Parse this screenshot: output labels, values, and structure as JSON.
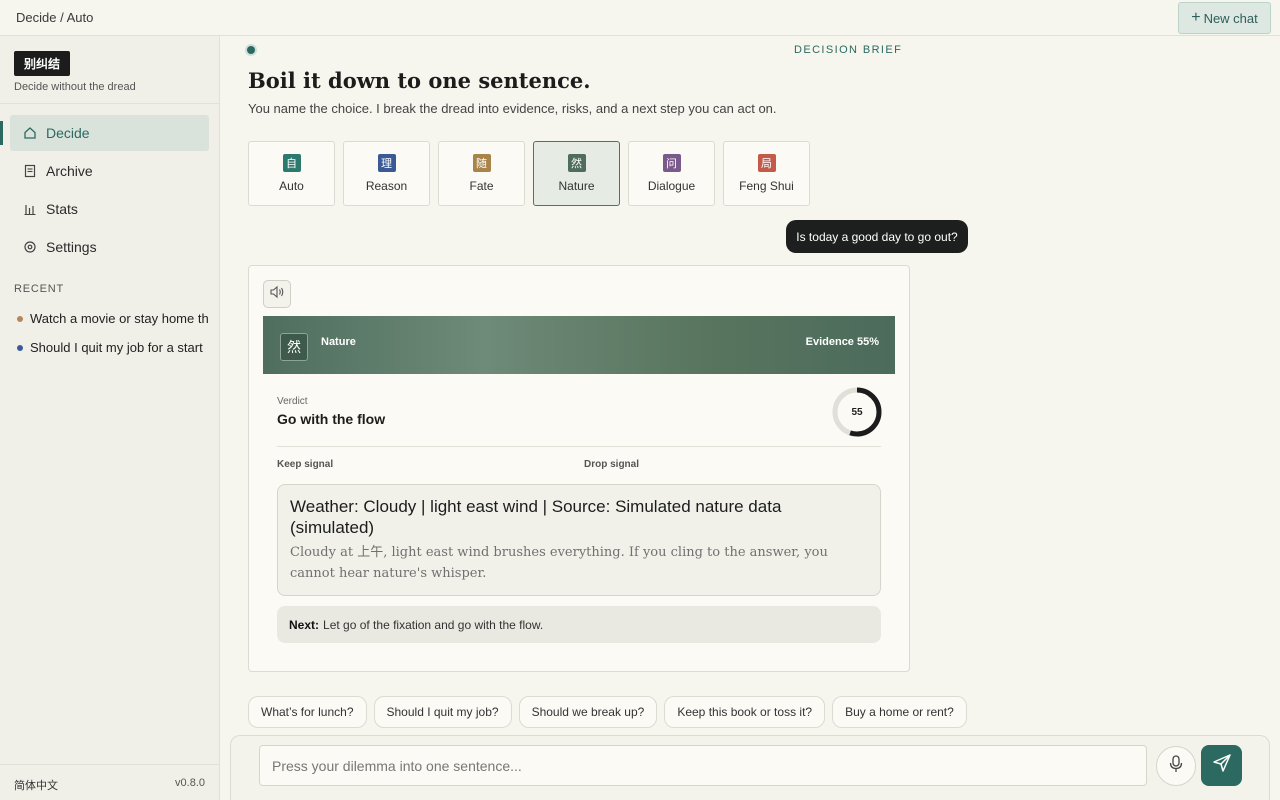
{
  "header": {
    "breadcrumb": "Decide / Auto",
    "new_chat_label": "New chat",
    "new_chat_icon": "plus-icon"
  },
  "sidebar": {
    "brand_name": "别纠结",
    "brand_tagline": "Decide without the dread",
    "items": [
      {
        "label": "Decide",
        "icon": "home-icon",
        "active": true
      },
      {
        "label": "Archive",
        "icon": "archive-icon",
        "active": false
      },
      {
        "label": "Stats",
        "icon": "bar-chart-icon",
        "active": false
      },
      {
        "label": "Settings",
        "icon": "gear-icon",
        "active": false
      }
    ],
    "recent_title": "RECENT",
    "recent": [
      {
        "label": "Watch a movie or stay home th",
        "color": "#b5875a"
      },
      {
        "label": "Should I quit my job for a start",
        "color": "#3c5a9a"
      }
    ],
    "language": "简体中文",
    "version": "v0.8.0"
  },
  "main": {
    "brief_label": "DECISION BRIEF",
    "headline": "Boil it down to one sentence.",
    "subheadline": "You name the choice. I break the dread into evidence, risks, and a next step you can act on.",
    "modes": [
      {
        "glyph": "自",
        "label": "Auto",
        "color": "#2c7a6e",
        "active": false
      },
      {
        "glyph": "理",
        "label": "Reason",
        "color": "#3b5a95",
        "active": false
      },
      {
        "glyph": "随",
        "label": "Fate",
        "color": "#a8834a",
        "active": false
      },
      {
        "glyph": "然",
        "label": "Nature",
        "color": "#4e6d5c",
        "active": true
      },
      {
        "glyph": "问",
        "label": "Dialogue",
        "color": "#7a5a8a",
        "active": false
      },
      {
        "glyph": "局",
        "label": "Feng Shui",
        "color": "#c45a4a",
        "active": false
      }
    ],
    "user_message": "Is today a good day to go out?"
  },
  "card": {
    "speak_icon": "speaker-icon",
    "banner_glyph": "然",
    "banner_mode": "Nature",
    "evidence_text": "Evidence 55%",
    "verdict_label": "Verdict",
    "verdict": "Go with the flow",
    "score": 55,
    "score_text": "55",
    "keep_label": "Keep signal",
    "drop_label": "Drop signal",
    "weather_title": "Weather:  Cloudy | light east wind | Source: Simulated nature data (simulated)",
    "weather_body": "Cloudy at 上午, light east wind brushes everything. If you cling to the answer, you cannot hear nature's whisper.",
    "next_label": "Next:",
    "next_text": "Let go of the fixation and go with the flow."
  },
  "suggestions": [
    "What’s for lunch?",
    "Should I quit my job?",
    "Should we break up?",
    "Keep this book or toss it?",
    "Buy a home or rent?"
  ],
  "composer": {
    "placeholder": "Press your dilemma into one sentence...",
    "mic_icon": "microphone-icon",
    "send_icon": "send-icon"
  },
  "colors": {
    "accent": "#2c6a61",
    "background": "#f6f5ee",
    "banner": "#577563"
  }
}
